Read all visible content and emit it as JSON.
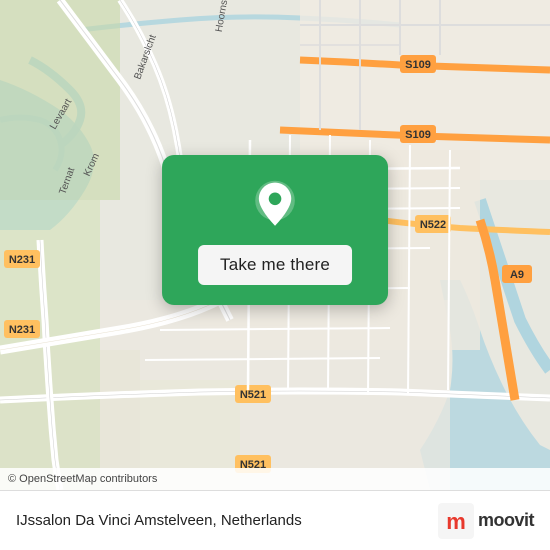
{
  "map": {
    "attribution": "© OpenStreetMap contributors",
    "center_lat": 52.298,
    "center_lon": 4.856
  },
  "popup": {
    "button_label": "Take me there"
  },
  "bottom_bar": {
    "location_text": "IJssalon Da Vinci Amstelveen, Netherlands"
  },
  "moovit": {
    "logo_text": "moovit"
  },
  "roads": {
    "labels": [
      "N231",
      "N231",
      "N521",
      "N521",
      "S109",
      "S109",
      "N522",
      "A9"
    ]
  }
}
